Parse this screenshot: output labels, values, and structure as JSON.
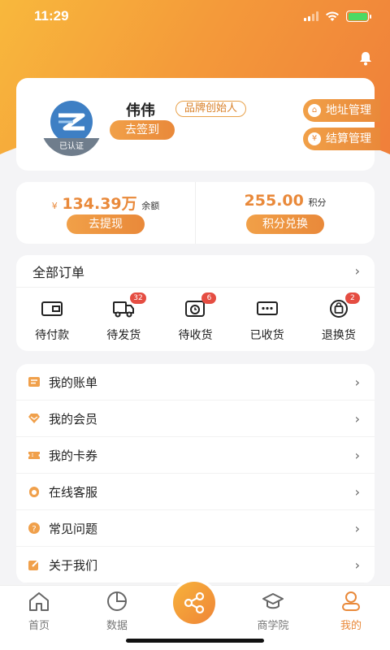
{
  "status_bar": {
    "time": "11:29"
  },
  "profile": {
    "name": "伟伟",
    "tag": "品牌创始人",
    "avatar_badge": "已认证",
    "checkin_label": "去签到",
    "address_label": "地址管理",
    "settlement_label": "结算管理"
  },
  "wallet": {
    "balance": {
      "currency": "¥",
      "value": "134.39万",
      "unit": "余额",
      "button": "去提现"
    },
    "points": {
      "value": "255.00",
      "unit": "积分",
      "button": "积分兑换"
    }
  },
  "orders": {
    "title": "全部订单",
    "items": [
      {
        "label": "待付款",
        "icon": "wallet-icon",
        "badge": ""
      },
      {
        "label": "待发货",
        "icon": "truck-icon",
        "badge": "32"
      },
      {
        "label": "待收货",
        "icon": "package-clock-icon",
        "badge": "6"
      },
      {
        "label": "已收货",
        "icon": "chat-dots-icon",
        "badge": ""
      },
      {
        "label": "退换货",
        "icon": "bag-return-icon",
        "badge": "2"
      }
    ]
  },
  "menu": [
    {
      "label": "我的账单",
      "icon": "bill-icon"
    },
    {
      "label": "我的会员",
      "icon": "diamond-icon"
    },
    {
      "label": "我的卡券",
      "icon": "coupon-icon"
    },
    {
      "label": "在线客服",
      "icon": "headset-icon"
    },
    {
      "label": "常见问题",
      "icon": "question-icon"
    },
    {
      "label": "关于我们",
      "icon": "edit-icon"
    }
  ],
  "tabbar": {
    "home": "首页",
    "data": "数据",
    "academy": "商学院",
    "mine": "我的",
    "active": "mine"
  },
  "colors": {
    "accent": "#e9893a",
    "badge": "#e54d42"
  }
}
